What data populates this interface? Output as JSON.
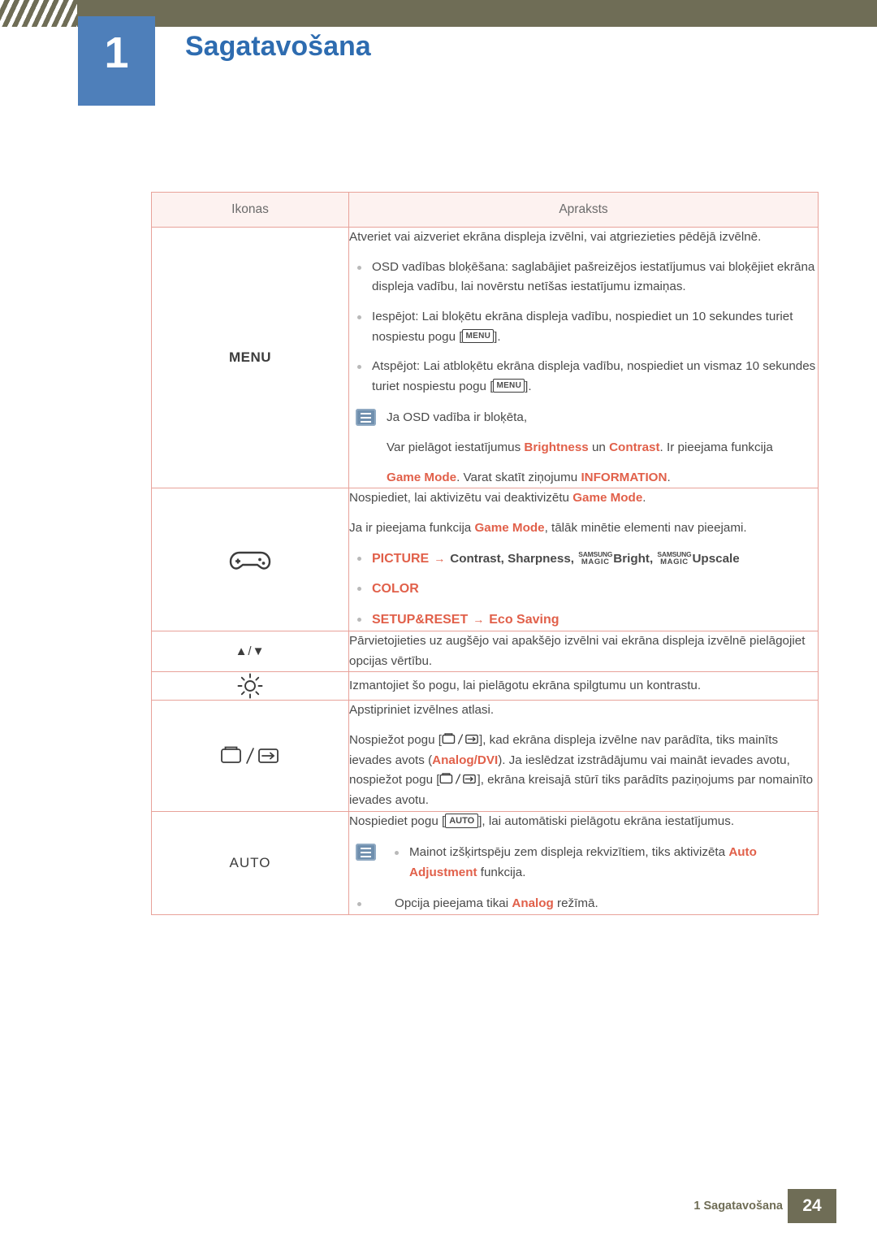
{
  "header": {
    "chapter_number": "1",
    "chapter_title": "Sagatavošana"
  },
  "table": {
    "headers": {
      "icons": "Ikonas",
      "description": "Apraksts"
    },
    "rows": [
      {
        "icon_label": "MENU",
        "icon_name": "menu-button-label",
        "desc": {
          "intro": "Atveriet vai aizveriet ekrāna displeja izvēlni, vai atgriezieties pēdējā izvēlnē.",
          "bullets": [
            "OSD vadības bloķēšana: saglabājiet pašreizējos iestatījumus vai bloķējiet ekrāna displeja vadību, lai novērstu netīšas iestatījumu izmaiņas.",
            "Iespējot: Lai bloķētu ekrāna displeja vadību, nospiediet un 10 sekundes turiet nospiestu pogu [MENU].",
            "Atspējot: Lai atbloķētu ekrāna displeja vadību, nospiediet un vismaz 10 sekundes turiet nospiestu pogu [MENU]."
          ],
          "bullet2_pre": "Iespējot: Lai bloķētu ekrāna displeja vadību, nospiediet un 10 sekundes turiet nospiestu pogu [",
          "bullet2_key": "MENU",
          "bullet2_post": "].",
          "bullet3_pre": "Atspējot: Lai atbloķētu ekrāna displeja vadību, nospiediet un vismaz 10 sekundes turiet nospiestu pogu [",
          "bullet3_key": "MENU",
          "bullet3_post": "].",
          "note_title": "Ja OSD vadība ir bloķēta,",
          "note_line1_a": "Var pielāgot iestatījumus ",
          "note_line1_k1": "Brightness",
          "note_line1_b": " un ",
          "note_line1_k2": "Contrast",
          "note_line1_c": ". Ir pieejama funkcija",
          "note_line2_k1": "Game Mode",
          "note_line2_a": ". Varat skatīt ziņojumu ",
          "note_line2_k2": "INFORMATION",
          "note_line2_b": "."
        }
      },
      {
        "icon_name": "gamepad-icon",
        "desc": {
          "line1_a": "Nospiediet, lai aktivizētu vai deaktivizētu ",
          "line1_k": "Game Mode",
          "line1_b": ".",
          "line2_a": "Ja ir pieejama funkcija ",
          "line2_k": "Game Mode",
          "line2_b": ", tālāk minētie elementi nav pieejami.",
          "item1_menu": "PICTURE",
          "item1_arrow": "→",
          "item1_rest_a": "Contrast, Sharpness, ",
          "item1_magic_top": "SAMSUNG",
          "item1_magic_bot": "MAGIC",
          "item1_rest_b": "Bright, ",
          "item1_rest_c": "Upscale",
          "item2_menu": "COLOR",
          "item3_menu": "SETUP&RESET",
          "item3_arrow": "→",
          "item3_rest": "Eco Saving"
        }
      },
      {
        "icon_label": "▲/▼",
        "icon_name": "up-down-arrows-icon",
        "desc": {
          "text": "Pārvietojieties uz augšējo vai apakšējo izvēlni vai ekrāna displeja izvēlnē pielāgojiet opcijas vērtību."
        }
      },
      {
        "icon_name": "brightness-icon",
        "desc": {
          "text": "Izmantojiet šo pogu, lai pielāgotu ekrāna spilgtumu un kontrastu."
        }
      },
      {
        "icon_name": "enter-source-icon",
        "desc": {
          "line1": "Apstipriniet izvēlnes atlasi.",
          "line2_a": "Nospiežot pogu [",
          "line2_b": "], kad ekrāna displeja izvēlne nav parādīta, tiks mainīts ievades avots (",
          "line2_k1": "Analog",
          "line2_sep": "/",
          "line2_k2": "DVI",
          "line2_c": "). Ja ieslēdzat izstrādājumu vai maināt ievades avotu, nospiežot pogu [",
          "line2_d": "], ekrāna kreisajā stūrī tiks parādīts paziņojums par nomainīto ievades avotu."
        }
      },
      {
        "icon_label": "AUTO",
        "icon_name": "auto-button-label",
        "desc": {
          "line1_a": "Nospiediet pogu [",
          "line1_key": "AUTO",
          "line1_b": "], lai automātiski pielāgotu ekrāna iestatījumus.",
          "note_bullet_a": "Mainot izšķirtspēju zem displeja rekvizītiem, tiks aktivizēta ",
          "note_bullet_k": "Auto Adjustment",
          "note_bullet_b": " funkcija.",
          "bullet2_a": "Opcija pieejama tikai ",
          "bullet2_k": "Analog",
          "bullet2_b": " režīmā."
        }
      }
    ]
  },
  "footer": {
    "text": "1 Sagatavošana",
    "page": "24"
  },
  "colors": {
    "accent_blue": "#2e6cb0",
    "accent_orange": "#e1604a",
    "header_olive": "#6f6d56",
    "table_border": "#e8a29a"
  }
}
